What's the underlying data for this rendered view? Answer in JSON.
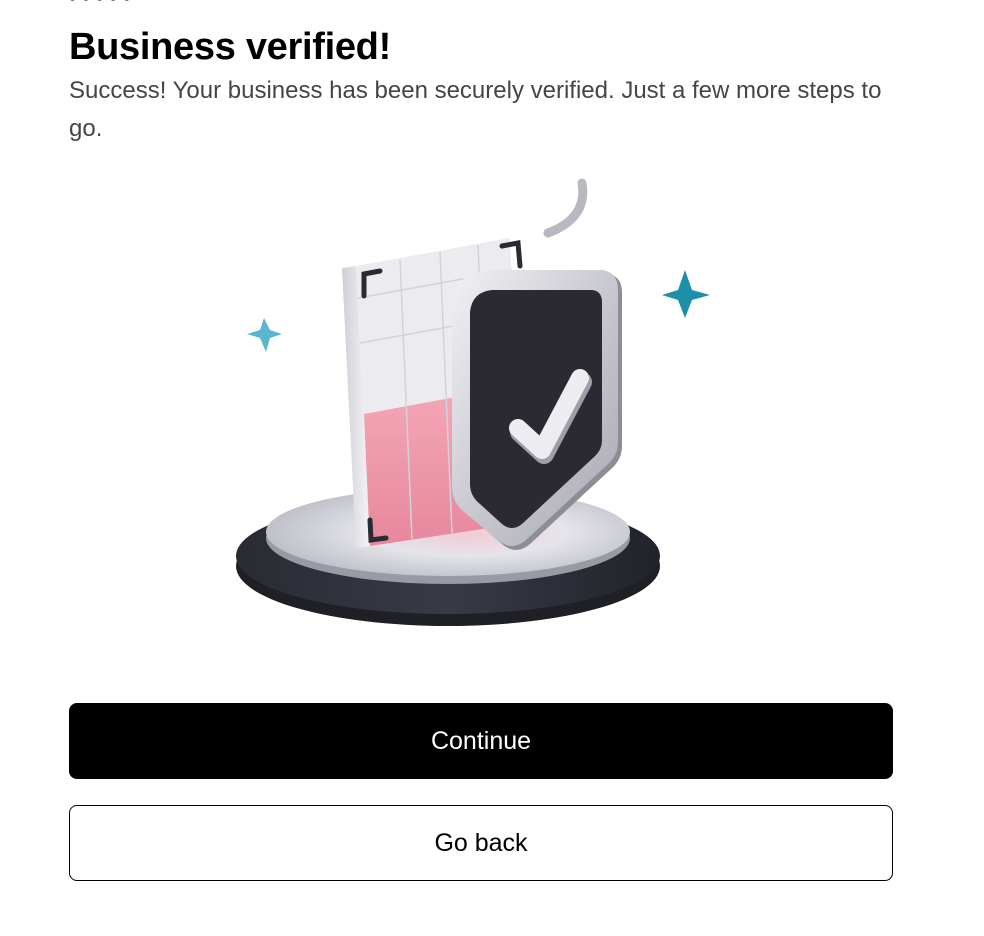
{
  "header": {
    "title": "Business verified!",
    "subtitle": "Success! Your business has been securely verified. Just a few more steps to go."
  },
  "illustration": {
    "icon": "verified-shield-icon",
    "accent_colors": [
      "#1e8fa8",
      "#f2a2b3",
      "#2b2a33"
    ]
  },
  "actions": {
    "continue_label": "Continue",
    "go_back_label": "Go back"
  },
  "colors": {
    "primary_button_bg": "#000000",
    "primary_button_text": "#ffffff",
    "secondary_button_border": "#000000"
  }
}
